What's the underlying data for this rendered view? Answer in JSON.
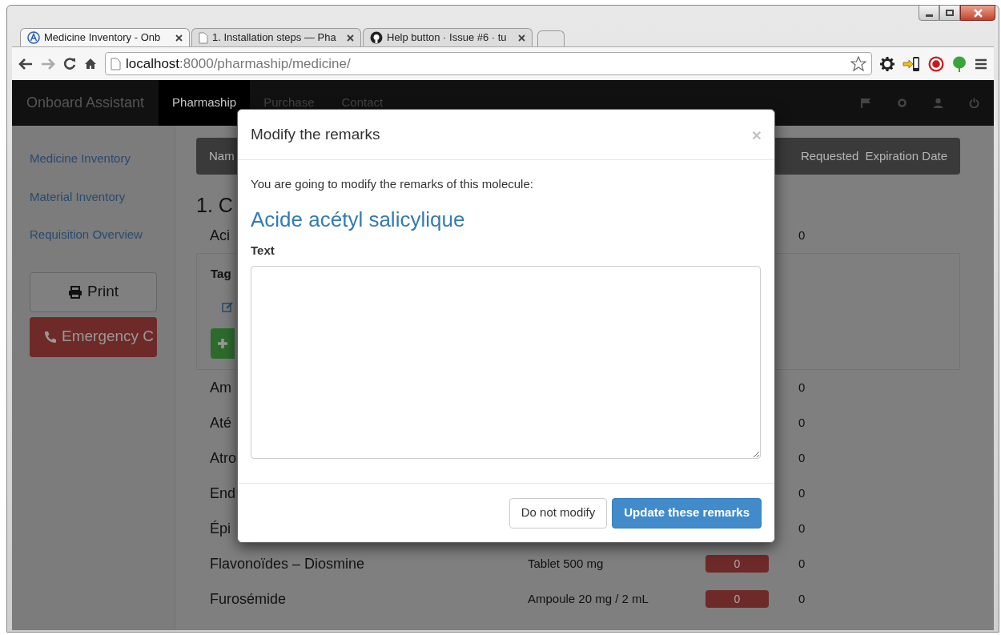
{
  "window": {
    "tabs": [
      {
        "title": "Medicine Inventory - Onb",
        "selected": true,
        "kind": "app"
      },
      {
        "title": "1. Installation steps — Pha",
        "selected": false,
        "kind": "page"
      },
      {
        "title": "Help button · Issue #6 · tu",
        "selected": false,
        "kind": "github"
      }
    ]
  },
  "address_bar": {
    "host": "localhost",
    "path": ":8000/pharmaship/medicine/"
  },
  "navbar": {
    "brand": "Onboard Assistant",
    "items": [
      {
        "label": "Pharmaship",
        "selected": true
      },
      {
        "label": "Purchase",
        "selected": false
      },
      {
        "label": "Contact",
        "selected": false
      }
    ]
  },
  "sidebar": {
    "items": [
      "Medicine Inventory",
      "Material Inventory",
      "Requisition Overview"
    ],
    "print_button": "Print",
    "emergency_button": "Emergency C"
  },
  "content": {
    "header_columns": [
      "Nam",
      "Requested",
      "Expiration Date"
    ],
    "section_title": "1. C",
    "first_row": {
      "name": "Aci",
      "count": "0"
    },
    "tags_label": "Tag",
    "rows": [
      {
        "name": "Am",
        "count": "0"
      },
      {
        "name": "Até",
        "count": "0"
      },
      {
        "name": "Atro",
        "count": "0"
      },
      {
        "name": "End",
        "count": "0"
      },
      {
        "name": "Épi",
        "count": "0"
      },
      {
        "name": "Flavonoïdes – Diosmine",
        "dosage": "Tablet 500 mg",
        "badge": "0",
        "count": "0"
      },
      {
        "name": "Furosémide",
        "dosage": "Ampoule 20 mg / 2 mL",
        "badge": "0",
        "count": "0"
      }
    ]
  },
  "modal": {
    "title": "Modify the remarks",
    "close": "×",
    "intro": "You are going to modify the remarks of this molecule:",
    "molecule": "Acide acétyl salicylique",
    "field_label": "Text",
    "buttons": [
      {
        "label": "Do not modify",
        "kind": "default"
      },
      {
        "label": "Update these remarks",
        "kind": "primary"
      }
    ]
  }
}
